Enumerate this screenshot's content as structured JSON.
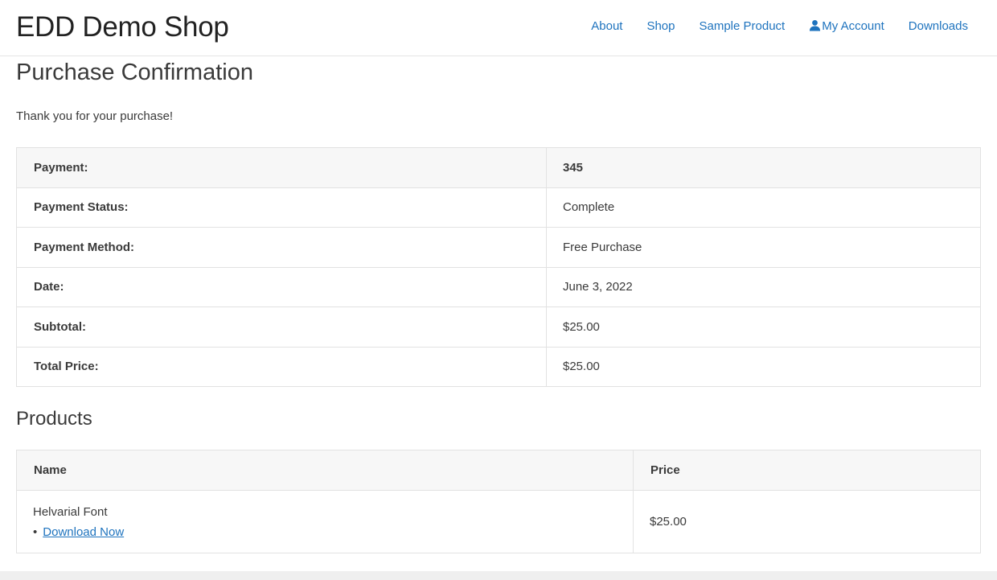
{
  "header": {
    "site_title": "EDD Demo Shop",
    "nav": [
      {
        "label": "About"
      },
      {
        "label": "Shop"
      },
      {
        "label": "Sample Product"
      },
      {
        "label": "My Account",
        "icon": "user-icon"
      },
      {
        "label": "Downloads"
      }
    ],
    "link_color": "#1e73be"
  },
  "page": {
    "title": "Purchase Confirmation",
    "thank_you": "Thank you for your purchase!"
  },
  "receipt": {
    "rows": [
      {
        "label": "Payment:",
        "value": "345"
      },
      {
        "label": "Payment Status:",
        "value": "Complete"
      },
      {
        "label": "Payment Method:",
        "value": "Free Purchase"
      },
      {
        "label": "Date:",
        "value": "June 3, 2022"
      },
      {
        "label": "Subtotal:",
        "value": "$25.00"
      },
      {
        "label": "Total Price:",
        "value": "$25.00"
      }
    ]
  },
  "products": {
    "title": "Products",
    "headers": {
      "name": "Name",
      "price": "Price"
    },
    "items": [
      {
        "name": "Helvarial Font",
        "download_label": "Download Now",
        "price": "$25.00"
      }
    ]
  }
}
